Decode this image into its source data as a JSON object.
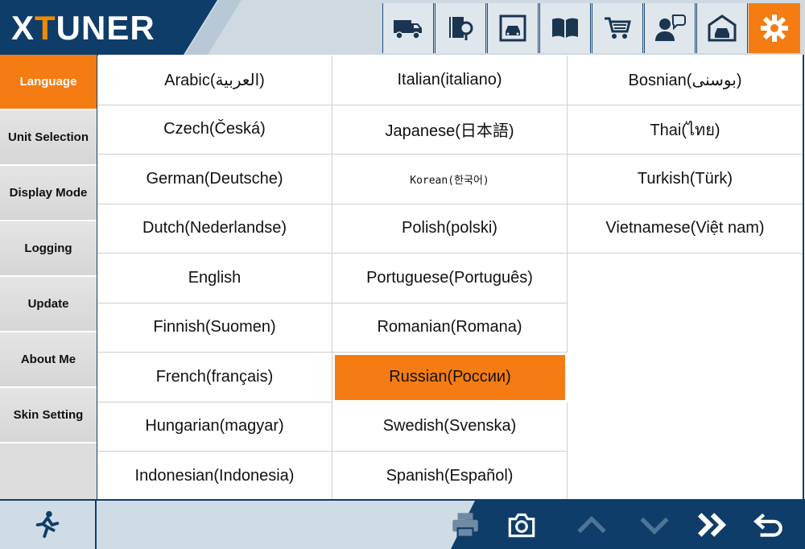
{
  "app": {
    "logo_left": "X",
    "logo_t": "T",
    "logo_right": "UNER"
  },
  "toolbar": {
    "icons": [
      "truck-icon",
      "manual-location-icon",
      "vehicle-scan-icon",
      "book-icon",
      "shopping-cart-icon",
      "support-chat-icon",
      "garage-icon",
      "settings-icon"
    ],
    "active": "settings-icon"
  },
  "sidebar": {
    "items": [
      {
        "label": "Language",
        "active": true
      },
      {
        "label": "Unit Selection"
      },
      {
        "label": "Display Mode"
      },
      {
        "label": "Logging"
      },
      {
        "label": "Update"
      },
      {
        "label": "About Me"
      },
      {
        "label": "Skin Setting"
      }
    ]
  },
  "languages": {
    "rows": [
      [
        "Arabic(العربية)",
        "Italian(italiano)",
        "Bosnian(بوسنى)"
      ],
      [
        "Czech(Česká)",
        "Japanese(日本語)",
        "Thai(ไทย)"
      ],
      [
        "German(Deutsche)",
        "Korean(한국어)",
        "Turkish(Türk)"
      ],
      [
        "Dutch(Nederlandse)",
        "Polish(polski)",
        "Vietnamese(Việt nam)"
      ],
      [
        "English",
        "Portuguese(Português)",
        ""
      ],
      [
        "Finnish(Suomen)",
        "Romanian(Romana)",
        ""
      ],
      [
        "French(français)",
        "Russian(России)",
        ""
      ],
      [
        "Hungarian(magyar)",
        "Swedish(Svenska)",
        ""
      ],
      [
        "Indonesian(Indonesia)",
        "Spanish(Español)",
        ""
      ]
    ],
    "selected": "Russian(России)"
  },
  "footer": {
    "icons": [
      "exit-icon",
      "print-icon",
      "camera-icon",
      "up-arrow-icon",
      "down-arrow-icon",
      "fast-forward-icon",
      "back-icon"
    ]
  },
  "colors": {
    "accent": "#f47c12",
    "navy": "#0f3d6a",
    "sidebar": "#dddddd"
  }
}
